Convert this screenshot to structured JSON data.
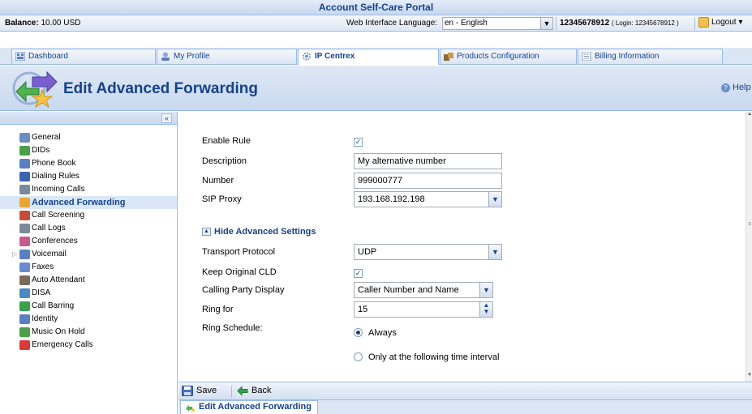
{
  "portal": {
    "title": "Account Self-Care Portal"
  },
  "infobar": {
    "balance_label": "Balance:",
    "balance_value": "10.00 USD",
    "language_label": "Web Interface Language:",
    "language_value": "en - English",
    "account_id": "12345678912",
    "login_text": "( Login: 12345678912 )",
    "logout_label": "Logout"
  },
  "tabs": [
    {
      "label": "Dashboard"
    },
    {
      "label": "My Profile"
    },
    {
      "label": "IP Centrex"
    },
    {
      "label": "Products Configuration"
    },
    {
      "label": "Billing Information"
    }
  ],
  "header": {
    "title": "Edit Advanced Forwarding",
    "help_label": "Help"
  },
  "sidebar": {
    "collapse_icon": "«",
    "items": [
      {
        "label": "General",
        "icon": "gear-icon",
        "color": "#6b8cc7"
      },
      {
        "label": "DIDs",
        "icon": "dids-icon",
        "color": "#4aa04a"
      },
      {
        "label": "Phone Book",
        "icon": "phone-book-icon",
        "color": "#5a7fc0"
      },
      {
        "label": "Dialing Rules",
        "icon": "dialing-rules-icon",
        "color": "#3a63b0"
      },
      {
        "label": "Incoming Calls",
        "icon": "incoming-calls-icon",
        "color": "#7a8a9a"
      },
      {
        "label": "Advanced Forwarding",
        "icon": "advanced-forwarding-icon",
        "color": "#e8a830"
      },
      {
        "label": "Call Screening",
        "icon": "call-screening-icon",
        "color": "#c84a3a"
      },
      {
        "label": "Call Logs",
        "icon": "call-logs-icon",
        "color": "#7a8a9a"
      },
      {
        "label": "Conferences",
        "icon": "conferences-icon",
        "color": "#c85a8a"
      },
      {
        "label": "Voicemail",
        "icon": "voicemail-icon",
        "color": "#5a7fc0"
      },
      {
        "label": "Faxes",
        "icon": "faxes-icon",
        "color": "#6a8ad0"
      },
      {
        "label": "Auto Attendant",
        "icon": "auto-attendant-icon",
        "color": "#7a6a5a"
      },
      {
        "label": "DISA",
        "icon": "disa-icon",
        "color": "#4a8ac0"
      },
      {
        "label": "Call Barring",
        "icon": "call-barring-icon",
        "color": "#3aa04a"
      },
      {
        "label": "Identity",
        "icon": "identity-icon",
        "color": "#5a7fc0"
      },
      {
        "label": "Music On Hold",
        "icon": "music-on-hold-icon",
        "color": "#4aa04a"
      },
      {
        "label": "Emergency Calls",
        "icon": "emergency-calls-icon",
        "color": "#d83a3a"
      }
    ]
  },
  "form": {
    "enable_rule_label": "Enable Rule",
    "enable_rule_checked": "✓",
    "description_label": "Description",
    "description_value": "My alternative number",
    "number_label": "Number",
    "number_value": "999000777",
    "sip_proxy_label": "SIP Proxy",
    "sip_proxy_value": "193.168.192.198",
    "hide_advanced_label": "Hide Advanced Settings",
    "transport_label": "Transport Protocol",
    "transport_value": "UDP",
    "keep_cld_label": "Keep Original CLD",
    "keep_cld_checked": "✓",
    "calling_party_label": "Calling Party Display",
    "calling_party_value": "Caller Number and Name",
    "ring_for_label": "Ring for",
    "ring_for_value": "15",
    "ring_schedule_label": "Ring Schedule:",
    "schedule_always": "Always",
    "schedule_interval": "Only at the following time interval"
  },
  "toolbar": {
    "save_label": "Save",
    "back_label": "Back"
  },
  "bottom_tab": {
    "label": "Edit Advanced Forwarding"
  },
  "colors": {
    "accent": "#15428b",
    "border": "#99bbe8",
    "panel": "#dfe8f6"
  }
}
